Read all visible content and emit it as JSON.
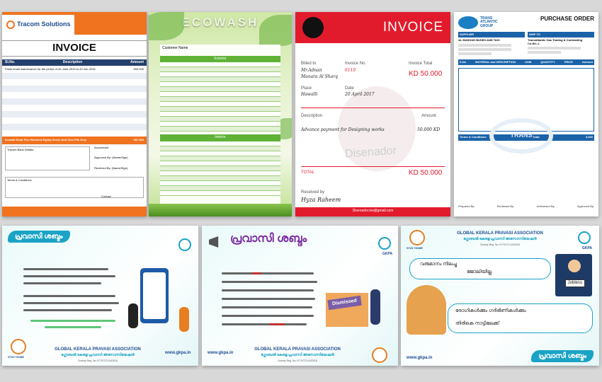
{
  "tiles": {
    "tracom": {
      "brand": "Tracom Solutions",
      "title": "INVOICE",
      "col_no": "Sl.No.",
      "col_desc": "Description",
      "col_amount": "Amount",
      "row1_desc": "Posts email maintenance for the period of 20-June-2019 to 20-Jun-2018",
      "row1_amount": "500.000",
      "total_text": "Kuwaiti Dinar Five Hundred Eighty Seven And Zero Fils Only",
      "total_amount": "587.000",
      "bank_label": "Tracom Bank Details :",
      "accountant": "Accountant",
      "approved": "Approved By: (Name/Sign)",
      "received": "Received By: (Name/Sign)",
      "terms": "Terms & Conditions",
      "contact": "Contact"
    },
    "ecowash": {
      "brand": "ECOWASH",
      "customer": "Customer Name",
      "section1": "Exterior",
      "section2": "Interior"
    },
    "red_invoice": {
      "title": "INVOICE",
      "billed_to_label": "Billed to",
      "billed_to_name": "Mr.Adnan",
      "billed_to_city": "Manara Al Sharq",
      "invoice_no_label": "Invoice No.",
      "invoice_no": "6110",
      "invoice_total_label": "Invoice Total",
      "invoice_total": "KD 50.000",
      "place_label": "Place",
      "place": "Hawalli",
      "date_label": "Date",
      "date": "20 April 2017",
      "description_label": "Description",
      "amount_label": "Amount",
      "line_desc": "Advance payment for Designing works",
      "line_amount": "50.000 KD",
      "watermark": "Disenador",
      "total_label": "TOTAL",
      "total": "KD 50.000",
      "received_label": "Received by",
      "received_name": "Hyza Raheem",
      "email": "Disenador.kw@gmail.com"
    },
    "purchase_order": {
      "brand": "TRANS ATLANTIC GROUP",
      "title": "PURCHASE ORDER",
      "supplier": "SUPPLIER",
      "ship_to": "SHIP TO",
      "supplier_name": "AL MASOUD BUSES AND TAXI",
      "ship_name": "TransAtlantic Gas Trading & Contracting Co.W.L.L",
      "col_sno": "S.No",
      "col_material": "MATERIAL and DESCRIPTION",
      "col_uom": "UOM",
      "col_qty": "QUANTITY",
      "col_price": "PRICE",
      "col_amount": "Amount",
      "terms": "Terms & Conditions",
      "total_label": "Total",
      "total": "3,000",
      "prepared": "Prepared By:",
      "reviewed": "Reviewed By:",
      "authorised": "Authorised By:",
      "approved": "Approved By:"
    },
    "gkpa": {
      "banner": "പ്രവാസി ശബ്ദം",
      "org": "GLOBAL KERALA PRAVASI ASSOCIATION",
      "org_ml": "ഗ്ലോബൽ കേരള പ്രവാസി അസോസിയേഷൻ",
      "reg": "Society Reg. No: KTYKTC/1/4/2018",
      "web": "www.gkpa.in",
      "short": "GKPA",
      "stay_home": "STAY HOME",
      "dismissed": "Dismissed",
      "jobless": "Jobless",
      "t7_line1": "വരുമാനം നിലച്ചു",
      "t7_line2": "ജോലിയില്ല",
      "t7_line3": "രോഗികൾക്കും ഗർഭിണികൾക്കും",
      "t7_line4": "തിരികെ നാട്ടിലേക്ക്"
    }
  }
}
